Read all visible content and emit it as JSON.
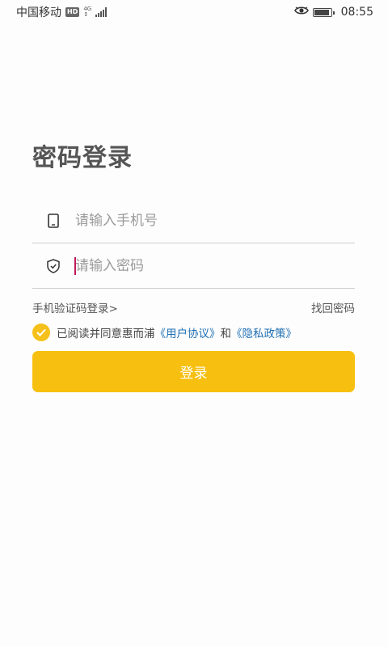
{
  "status_bar": {
    "carrier": "中国移动",
    "hd": "HD",
    "network_top": "4G",
    "network_bottom": "↕",
    "time": "08:55",
    "battery_level": 0.9
  },
  "page": {
    "title": "密码登录"
  },
  "form": {
    "phone_placeholder": "请输入手机号",
    "password_placeholder": "请输入密码",
    "sms_login_link": "手机验证码登录>",
    "forgot_password_link": "找回密码",
    "agreement_prefix": "已阅读并同意惠而浦",
    "user_agreement": "《用户协议》",
    "conjunction": "和",
    "privacy_policy": "《隐私政策》",
    "login_button": "登录"
  },
  "icons": {
    "phone": "phone-icon",
    "shield": "shield-icon",
    "check": "check-icon",
    "eye": "eye-icon"
  },
  "colors": {
    "accent": "#f7bf0f",
    "link": "#1f6fb3",
    "cursor": "#c2185b"
  }
}
